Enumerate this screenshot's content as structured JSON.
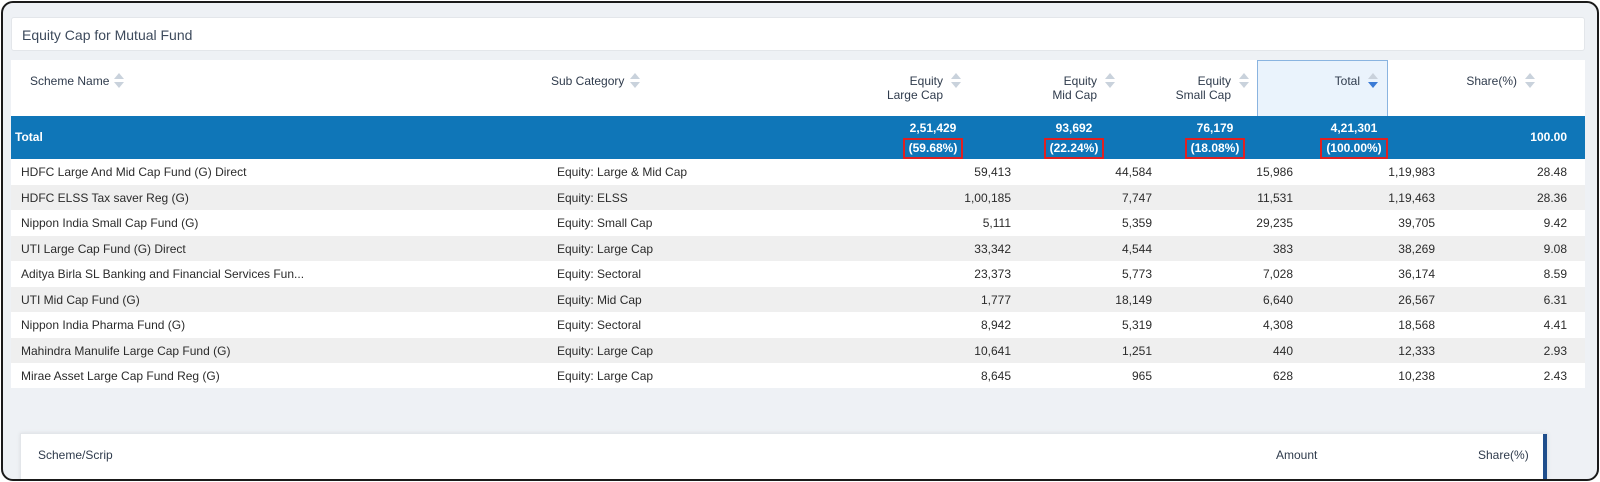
{
  "title": "Equity Cap for Mutual Fund",
  "columns": {
    "scheme_name": "Scheme Name",
    "sub_category": "Sub Category",
    "large_line1": "Equity",
    "large_line2": "Large Cap",
    "mid_line1": "Equity",
    "mid_line2": "Mid Cap",
    "small_line1": "Equity",
    "small_line2": "Small Cap",
    "total": "Total",
    "share": "Share(%)"
  },
  "total_row": {
    "label": "Total",
    "large": "2,51,429",
    "large_pct": "(59.68%)",
    "mid": "93,692",
    "mid_pct": "(22.24%)",
    "small": "76,179",
    "small_pct": "(18.08%)",
    "total": "4,21,301",
    "total_pct": "(100.00%)",
    "share": "100.00"
  },
  "rows": [
    {
      "name": "HDFC Large And Mid Cap Fund (G) Direct",
      "sub": "Equity: Large & Mid Cap",
      "large": "59,413",
      "mid": "44,584",
      "small": "15,986",
      "total": "1,19,983",
      "share": "28.48"
    },
    {
      "name": "HDFC ELSS Tax saver Reg (G)",
      "sub": "Equity: ELSS",
      "large": "1,00,185",
      "mid": "7,747",
      "small": "11,531",
      "total": "1,19,463",
      "share": "28.36"
    },
    {
      "name": "Nippon India Small Cap Fund (G)",
      "sub": "Equity: Small Cap",
      "large": "5,111",
      "mid": "5,359",
      "small": "29,235",
      "total": "39,705",
      "share": "9.42"
    },
    {
      "name": "UTI Large Cap Fund (G) Direct",
      "sub": "Equity: Large Cap",
      "large": "33,342",
      "mid": "4,544",
      "small": "383",
      "total": "38,269",
      "share": "9.08"
    },
    {
      "name": "Aditya Birla SL Banking and Financial Services Fun...",
      "sub": "Equity: Sectoral",
      "large": "23,373",
      "mid": "5,773",
      "small": "7,028",
      "total": "36,174",
      "share": "8.59"
    },
    {
      "name": "UTI Mid Cap Fund (G)",
      "sub": "Equity: Mid Cap",
      "large": "1,777",
      "mid": "18,149",
      "small": "6,640",
      "total": "26,567",
      "share": "6.31"
    },
    {
      "name": "Nippon India Pharma Fund (G)",
      "sub": "Equity: Sectoral",
      "large": "8,942",
      "mid": "5,319",
      "small": "4,308",
      "total": "18,568",
      "share": "4.41"
    },
    {
      "name": "Mahindra Manulife Large Cap Fund (G)",
      "sub": "Equity: Large Cap",
      "large": "10,641",
      "mid": "1,251",
      "small": "440",
      "total": "12,333",
      "share": "2.93"
    },
    {
      "name": "Mirae Asset Large Cap Fund Reg (G)",
      "sub": "Equity: Large Cap",
      "large": "8,645",
      "mid": "965",
      "small": "628",
      "total": "10,238",
      "share": "2.43"
    }
  ],
  "bottom": {
    "scheme_scrip": "Scheme/Scrip",
    "amount": "Amount",
    "share": "Share(%)"
  },
  "colors": {
    "total_row_bg": "#0f76b8",
    "highlight_border": "#e02020",
    "active_sort": "#3a7bd5"
  }
}
